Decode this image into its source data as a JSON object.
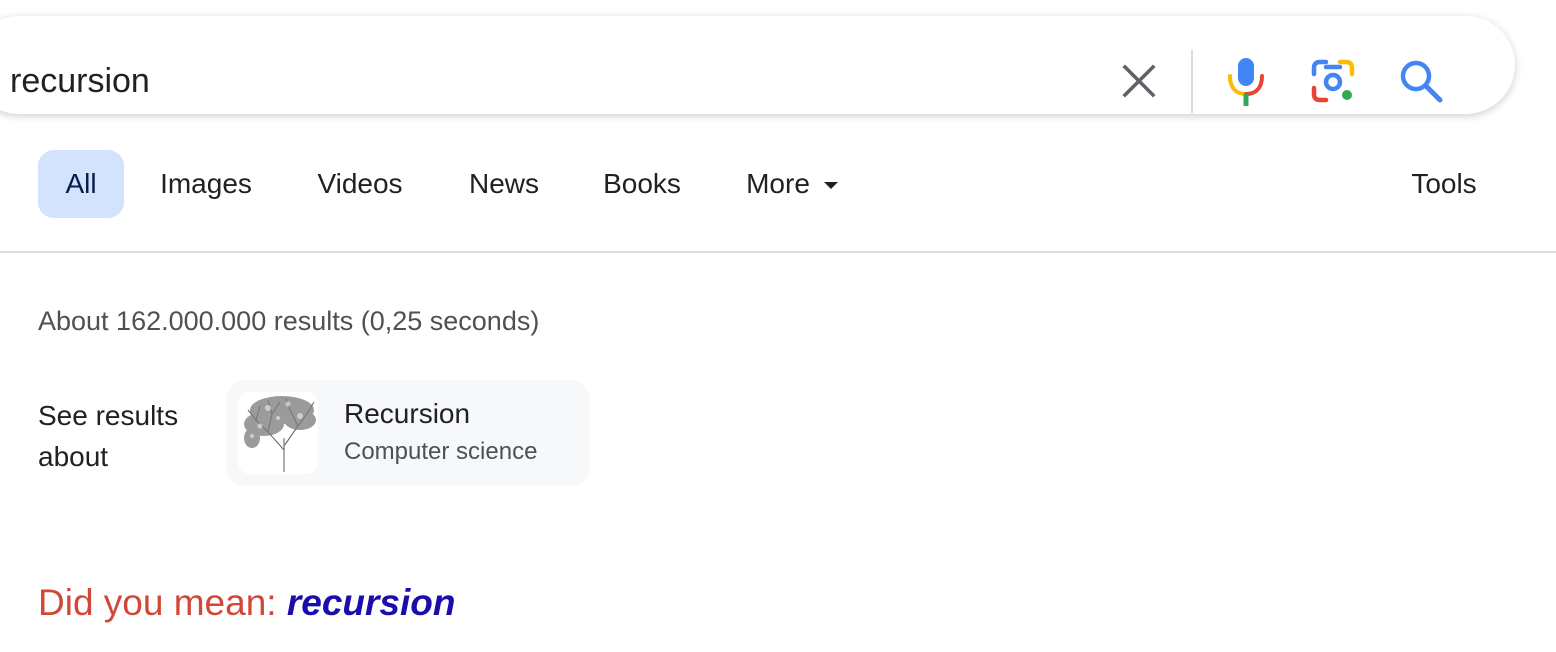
{
  "search": {
    "query": "recursion"
  },
  "tabs": [
    {
      "label": "All",
      "active": true
    },
    {
      "label": "Images"
    },
    {
      "label": "Videos"
    },
    {
      "label": "News"
    },
    {
      "label": "Books"
    },
    {
      "label": "More"
    }
  ],
  "tools_label": "Tools",
  "result_stats": "About 162.000.000 results (0,25 seconds)",
  "see_results": {
    "label": "See results about",
    "entity": {
      "title": "Recursion",
      "subtitle": "Computer science",
      "thumbnail": "tree-fractal-image"
    }
  },
  "did_you_mean": {
    "prefix": "Did you mean: ",
    "suggestion": "recursion"
  },
  "colors": {
    "active_tab_bg": "#d3e3fd",
    "did_you_mean_prefix": "#d14836",
    "suggestion_link": "#1a0dab",
    "google_blue": "#4285f4",
    "google_red": "#ea4335",
    "google_yellow": "#fbbc04",
    "google_green": "#34a853"
  },
  "icons": {
    "clear": "close-icon",
    "voice": "microphone-icon",
    "lens": "camera-lens-icon",
    "search": "search-icon",
    "more": "caret-down-icon"
  }
}
